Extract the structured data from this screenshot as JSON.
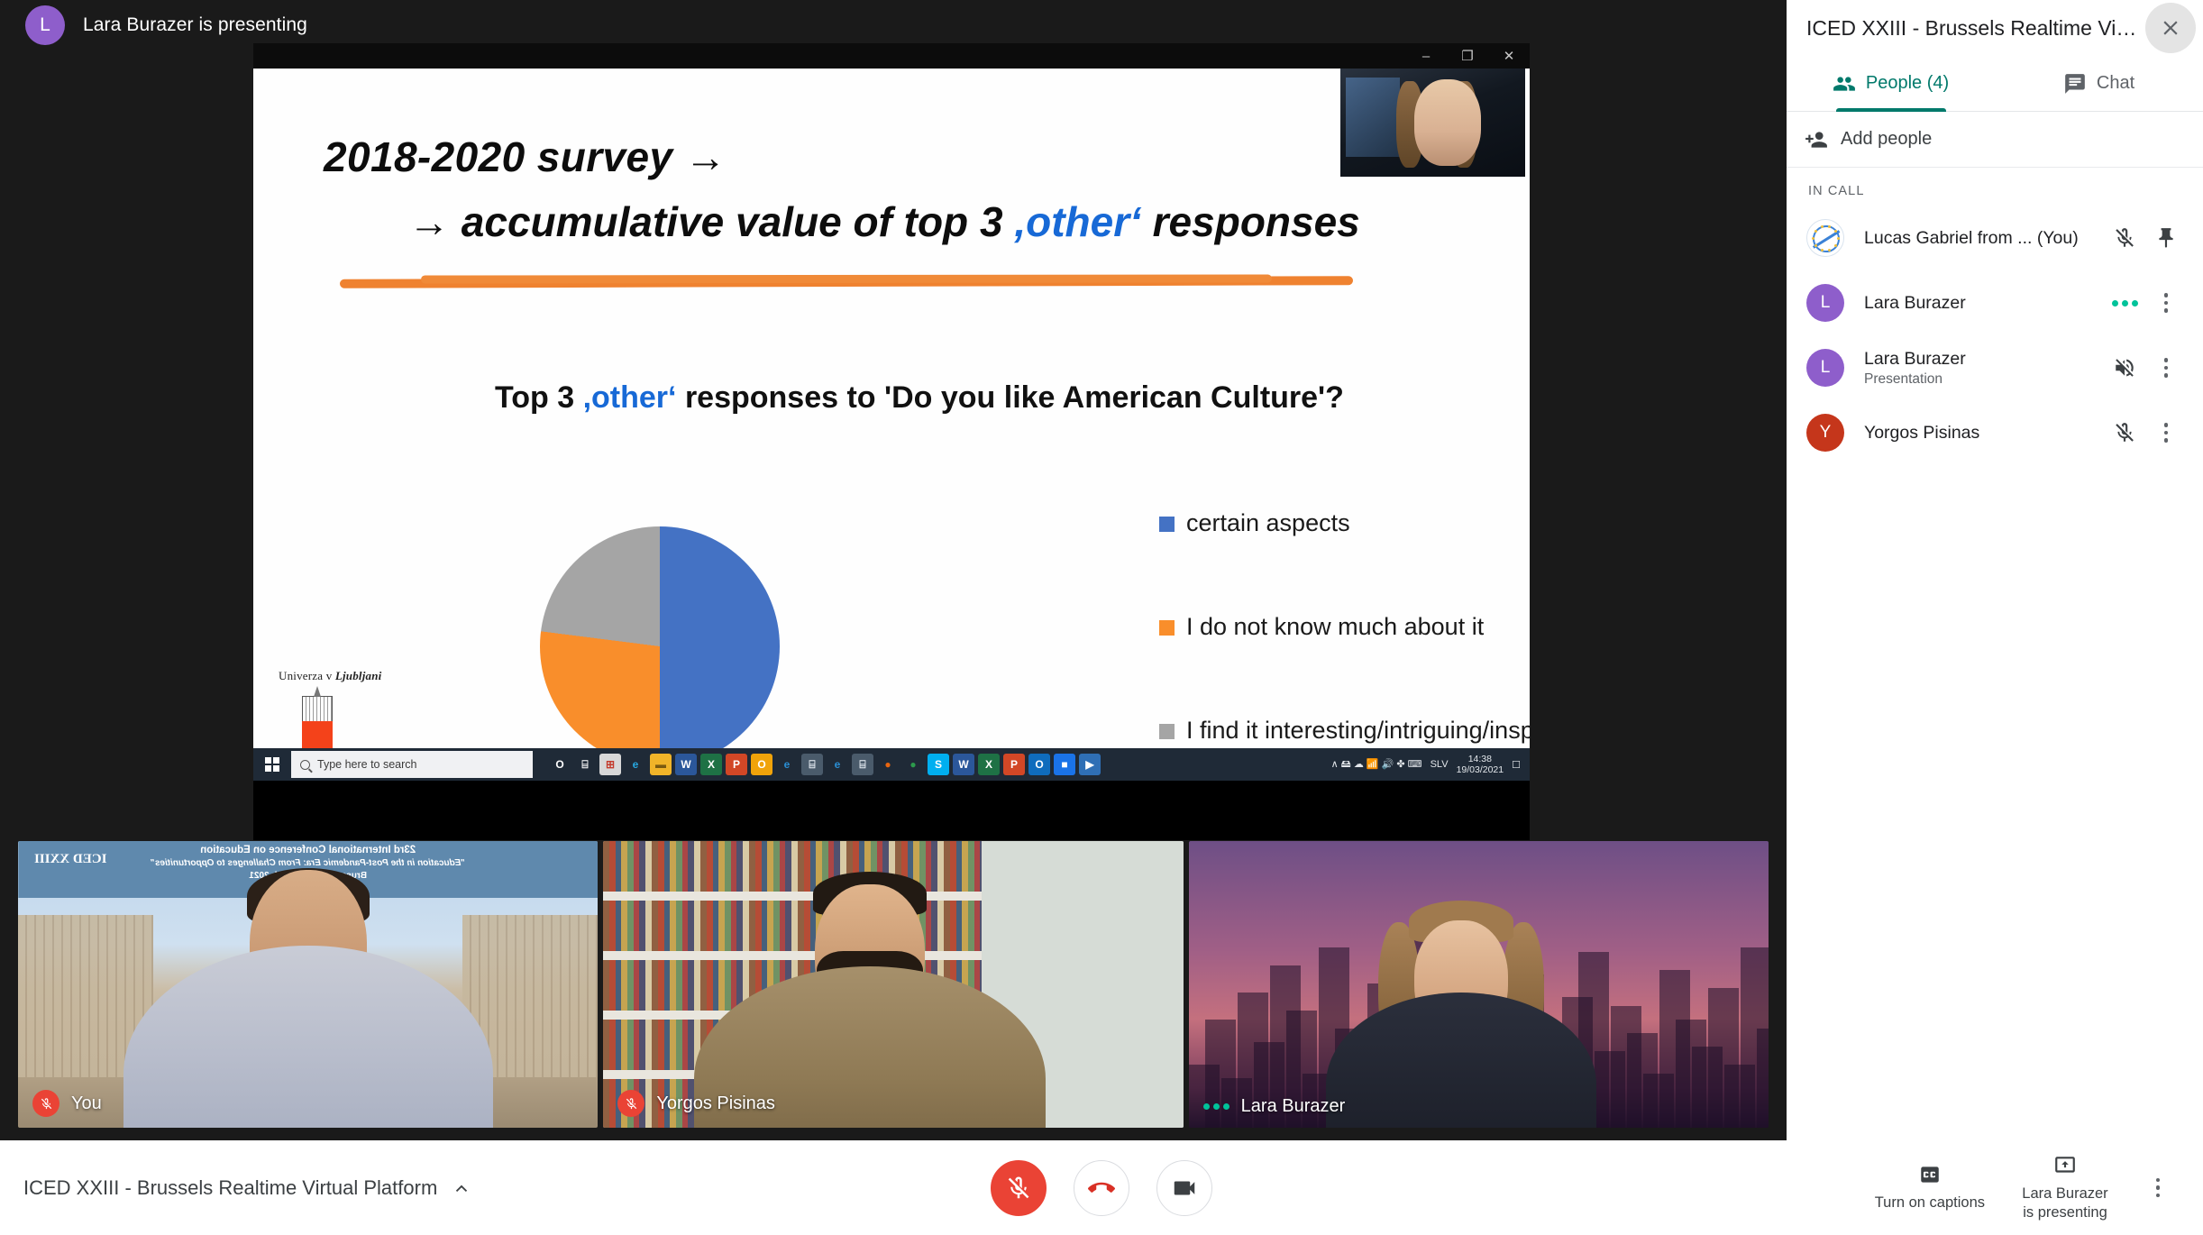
{
  "meeting": {
    "presenting_banner": {
      "avatar_letter": "L",
      "avatar_color": "#8e5ecb",
      "text": "Lara Burazer is presenting"
    }
  },
  "shared_screen": {
    "window_controls": {
      "minimize": "–",
      "restore": "❐",
      "close": "✕"
    },
    "slide": {
      "heading_line1": "2018-2020 survey →",
      "heading_line2_pre": "→ accumulative value of top 3 ",
      "heading_line2_blue": ",other‘",
      "heading_line2_post": " responses",
      "subtitle_pre": "Top 3 ",
      "subtitle_blue": ",other‘",
      "subtitle_post": " responses to 'Do you like American Culture'?",
      "accent_rule_color": "#ef8230",
      "blue_color": "#1769d6",
      "university_logo_text_plain": "Univerza v ",
      "university_logo_text_italic": "Ljubljani"
    },
    "taskbar": {
      "search_placeholder": "Type here to search",
      "clock_time": "14:38",
      "clock_date": "19/03/2021",
      "language": "SLV",
      "icons": [
        {
          "name": "cortana-icon",
          "glyph": "O",
          "bg": "#1f2a37",
          "fg": "#ffffff"
        },
        {
          "name": "task-view-icon",
          "glyph": "⌸",
          "bg": "#1f2a37",
          "fg": "#ffffff"
        },
        {
          "name": "microsoft-store-icon",
          "glyph": "⊞",
          "bg": "#d8d8d8",
          "fg": "#c43b2c"
        },
        {
          "name": "microsoft-edge-icon",
          "glyph": "e",
          "bg": "#1f2a37",
          "fg": "#27a8e0"
        },
        {
          "name": "file-explorer-icon",
          "glyph": "▬",
          "bg": "#f0b429",
          "fg": "#7a5a10"
        },
        {
          "name": "word-icon",
          "glyph": "W",
          "bg": "#2b579a",
          "fg": "#ffffff"
        },
        {
          "name": "excel-icon",
          "glyph": "X",
          "bg": "#1e7145",
          "fg": "#ffffff"
        },
        {
          "name": "powerpoint-icon",
          "glyph": "P",
          "bg": "#d24726",
          "fg": "#ffffff"
        },
        {
          "name": "outlook-icon",
          "glyph": "O",
          "bg": "#f0a30a",
          "fg": "#ffffff"
        },
        {
          "name": "internet-explorer-icon",
          "glyph": "e",
          "bg": "#1f2a37",
          "fg": "#2a8fd4"
        },
        {
          "name": "calculator-icon",
          "glyph": "⌸",
          "bg": "#4a5b6b",
          "fg": "#e8eef5"
        },
        {
          "name": "internet-explorer-2-icon",
          "glyph": "e",
          "bg": "#1f2a37",
          "fg": "#2a8fd4"
        },
        {
          "name": "calculator-2-icon",
          "glyph": "⌸",
          "bg": "#4a5b6b",
          "fg": "#e8eef5"
        },
        {
          "name": "firefox-icon",
          "glyph": "●",
          "bg": "#1f2a37",
          "fg": "#e8650f"
        },
        {
          "name": "chrome-icon",
          "glyph": "●",
          "bg": "#1f2a37",
          "fg": "#2c9a4c"
        },
        {
          "name": "skype-icon",
          "glyph": "S",
          "bg": "#00aff0",
          "fg": "#ffffff"
        },
        {
          "name": "word-2-icon",
          "glyph": "W",
          "bg": "#2b579a",
          "fg": "#ffffff"
        },
        {
          "name": "excel-2-icon",
          "glyph": "X",
          "bg": "#1e7145",
          "fg": "#ffffff"
        },
        {
          "name": "powerpoint-2-icon",
          "glyph": "P",
          "bg": "#d24726",
          "fg": "#ffffff"
        },
        {
          "name": "outlook-2-icon",
          "glyph": "O",
          "bg": "#0f6cbd",
          "fg": "#ffffff"
        },
        {
          "name": "meet-icon",
          "glyph": "■",
          "bg": "#1a73e8",
          "fg": "#ffffff"
        },
        {
          "name": "powerpoint-show-icon",
          "glyph": "▶",
          "bg": "#2f6fb5",
          "fg": "#ffffff"
        }
      ],
      "tray": [
        "∧",
        "🖴",
        "☁",
        "📶",
        "🔊",
        "✤",
        "⌨"
      ]
    }
  },
  "chart_data": {
    "type": "pie",
    "title": "Top 3 ,other' responses to 'Do you like American Culture'?",
    "categories": [
      "certain aspects",
      "I do not know much about it",
      "I find it interesting/intriguing/inspirational"
    ],
    "values": [
      50,
      27,
      23
    ],
    "colors": [
      "#4472c4",
      "#f98e2b",
      "#a5a5a5"
    ],
    "legend_position": "right",
    "grid": false,
    "unit": "%"
  },
  "tiles": [
    {
      "name": "You",
      "mic": "muted",
      "speaking": false,
      "banner": {
        "line1": "23rd International Conference on Education",
        "line2": "\"Education in the Post-Pandemic Era: From Challenges to Opportunities\"",
        "line3": "Brussels, 19-20 March 2021",
        "logo": "ICED XXIII"
      }
    },
    {
      "name": "Yorgos Pisinas",
      "mic": "muted",
      "speaking": false
    },
    {
      "name": "Lara Burazer",
      "mic": "on",
      "speaking": true
    }
  ],
  "panel": {
    "title": "ICED XXIII - Brussels Realtime Virt...",
    "close_label": "✕",
    "tabs": [
      {
        "label": "People (4)",
        "icon": "people-icon",
        "active": true
      },
      {
        "label": "Chat",
        "icon": "chat-icon",
        "active": false
      }
    ],
    "add_people_label": "Add people",
    "section_label": "IN CALL",
    "accent_color": "#00796b",
    "participants": [
      {
        "name": "Lucas Gabriel from ... (You)",
        "sub": "",
        "avatar_letter": "",
        "avatar_color": "#ffffff",
        "avatar_type": "logo",
        "action1": "mic-off-icon",
        "action2": "pin-icon"
      },
      {
        "name": "Lara Burazer",
        "sub": "",
        "avatar_letter": "L",
        "avatar_color": "#8e5ecb",
        "avatar_type": "letter",
        "action1": "speaking-dots",
        "action2": "kebab-icon"
      },
      {
        "name": "Lara Burazer",
        "sub": "Presentation",
        "avatar_letter": "L",
        "avatar_color": "#8e5ecb",
        "avatar_type": "letter",
        "action1": "volume-off-icon",
        "action2": "kebab-icon"
      },
      {
        "name": "Yorgos Pisinas",
        "sub": "",
        "avatar_letter": "Y",
        "avatar_color": "#c5361b",
        "avatar_type": "letter",
        "action1": "mic-off-icon",
        "action2": "kebab-icon"
      }
    ]
  },
  "bottombar": {
    "meeting_name": "ICED XXIII - Brussels Realtime Virtual Platform",
    "expand_icon": "chevron-up-icon",
    "controls": [
      {
        "name": "microphone-off-button",
        "icon": "mic-off-icon",
        "state": "muted"
      },
      {
        "name": "hang-up-button",
        "icon": "phone-hangup-icon",
        "state": "normal"
      },
      {
        "name": "camera-button",
        "icon": "camera-icon",
        "state": "normal"
      }
    ],
    "captions_label": "Turn on captions",
    "present_label_line1": "Lara Burazer",
    "present_label_line2": "is presenting",
    "more_icon": "kebab-icon"
  }
}
